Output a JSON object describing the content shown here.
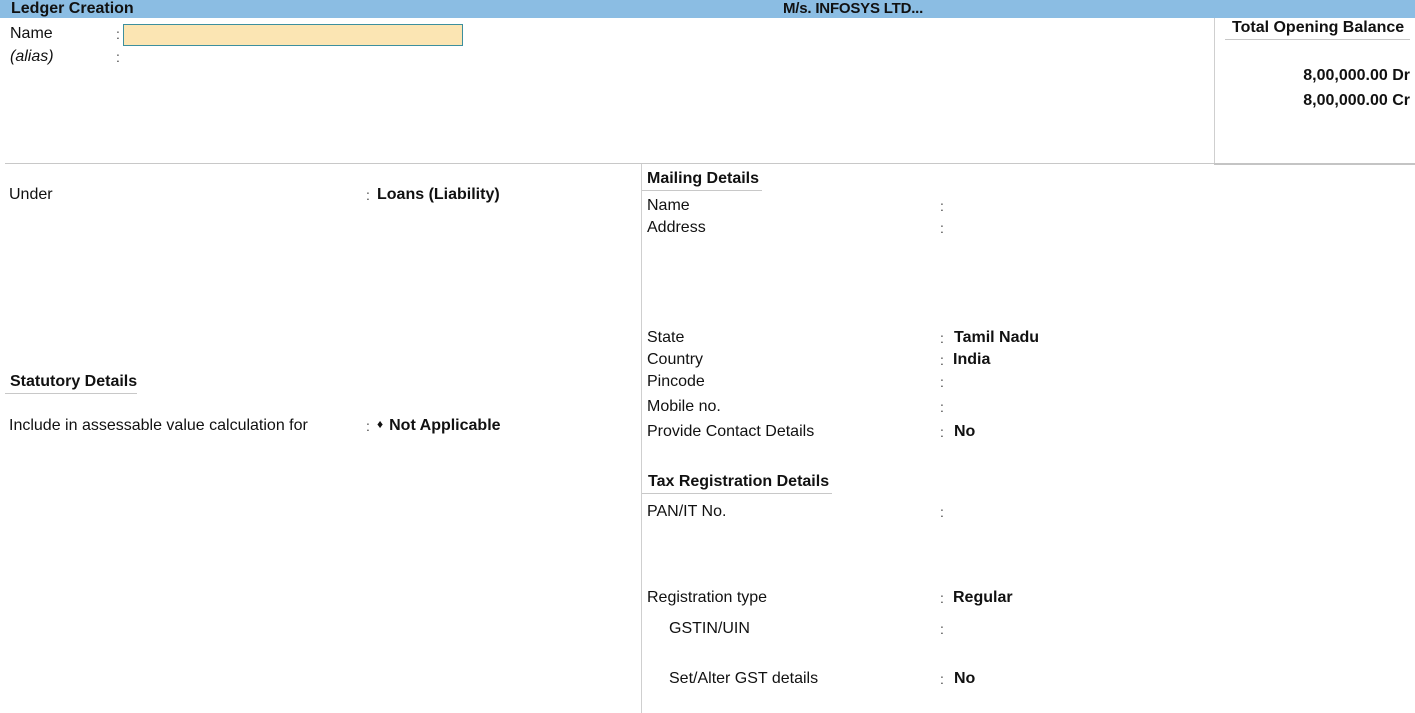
{
  "titlebar": {
    "screen_title": "Ledger Creation",
    "company": "M/s. INFOSYS LTD..."
  },
  "ledger": {
    "name_label": "Name",
    "name_value": "",
    "alias_label": "(alias)",
    "colon": ":"
  },
  "opening_balance": {
    "title": "Total Opening Balance",
    "debit": "8,00,000.00 Dr",
    "credit": "8,00,000.00 Cr"
  },
  "left": {
    "under_label": "Under",
    "under_value": "Loans (Liability)",
    "statutory_title": "Statutory Details",
    "assessable_label": "Include in assessable value calculation for",
    "assessable_value": "Not Applicable",
    "assessable_icon": "diamond-icon"
  },
  "mailing": {
    "title": "Mailing Details",
    "fields": [
      {
        "label": "Name",
        "value": ""
      },
      {
        "label": "Address",
        "value": ""
      },
      {
        "label": "State",
        "value": "Tamil Nadu"
      },
      {
        "label": "Country",
        "value": "India"
      },
      {
        "label": "Pincode",
        "value": ""
      },
      {
        "label": "Mobile no.",
        "value": ""
      },
      {
        "label": "Provide Contact Details",
        "value": "No"
      }
    ]
  },
  "tax": {
    "title": "Tax Registration Details",
    "fields": [
      {
        "label": "PAN/IT No.",
        "value": ""
      },
      {
        "label": "Registration type",
        "value": "Regular"
      },
      {
        "label": "GSTIN/UIN",
        "value": ""
      },
      {
        "label": "Set/Alter GST details",
        "value": "No"
      }
    ]
  }
}
